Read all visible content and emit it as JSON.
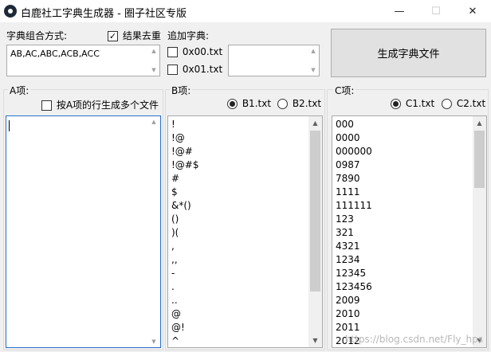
{
  "window": {
    "title": "白鹿社工字典生成器 - 圈子社区专版",
    "minimize_glyph": "—",
    "maximize_glyph": "☐",
    "close_glyph": "✕"
  },
  "combo": {
    "label": "字典组合方式:",
    "value": "AB,AC,ABC,ACB,ACC"
  },
  "dedupe": {
    "label": "结果去重",
    "checked": true,
    "check_glyph": "✓"
  },
  "append_dict": {
    "label": "追加字典:",
    "options": [
      {
        "label": "0x00.txt",
        "checked": false
      },
      {
        "label": "0x01.txt",
        "checked": false
      }
    ],
    "value": ""
  },
  "generate_button": {
    "label": "生成字典文件"
  },
  "group_a": {
    "label": "A项:",
    "multi_file_label": "按A项的行生成多个文件",
    "items": []
  },
  "group_b": {
    "label": "B项:",
    "radio1": "B1.txt",
    "radio2": "B2.txt",
    "selected": "B1.txt",
    "items": [
      "!",
      "!@",
      "!@#",
      "!@#$",
      "#",
      "$",
      "&*()",
      "()",
      ")(",
      ",",
      ",,",
      "-",
      ".",
      "..",
      "@",
      "@!",
      "^"
    ]
  },
  "group_c": {
    "label": "C项:",
    "radio1": "C1.txt",
    "radio2": "C2.txt",
    "selected": "C1.txt",
    "items": [
      "000",
      "0000",
      "000000",
      "0987",
      "7890",
      "1111",
      "111111",
      "123",
      "321",
      "4321",
      "1234",
      "12345",
      "123456",
      "2009",
      "2010",
      "2011",
      "2012"
    ]
  },
  "watermark": "https://blog.csdn.net/Fly_hps"
}
